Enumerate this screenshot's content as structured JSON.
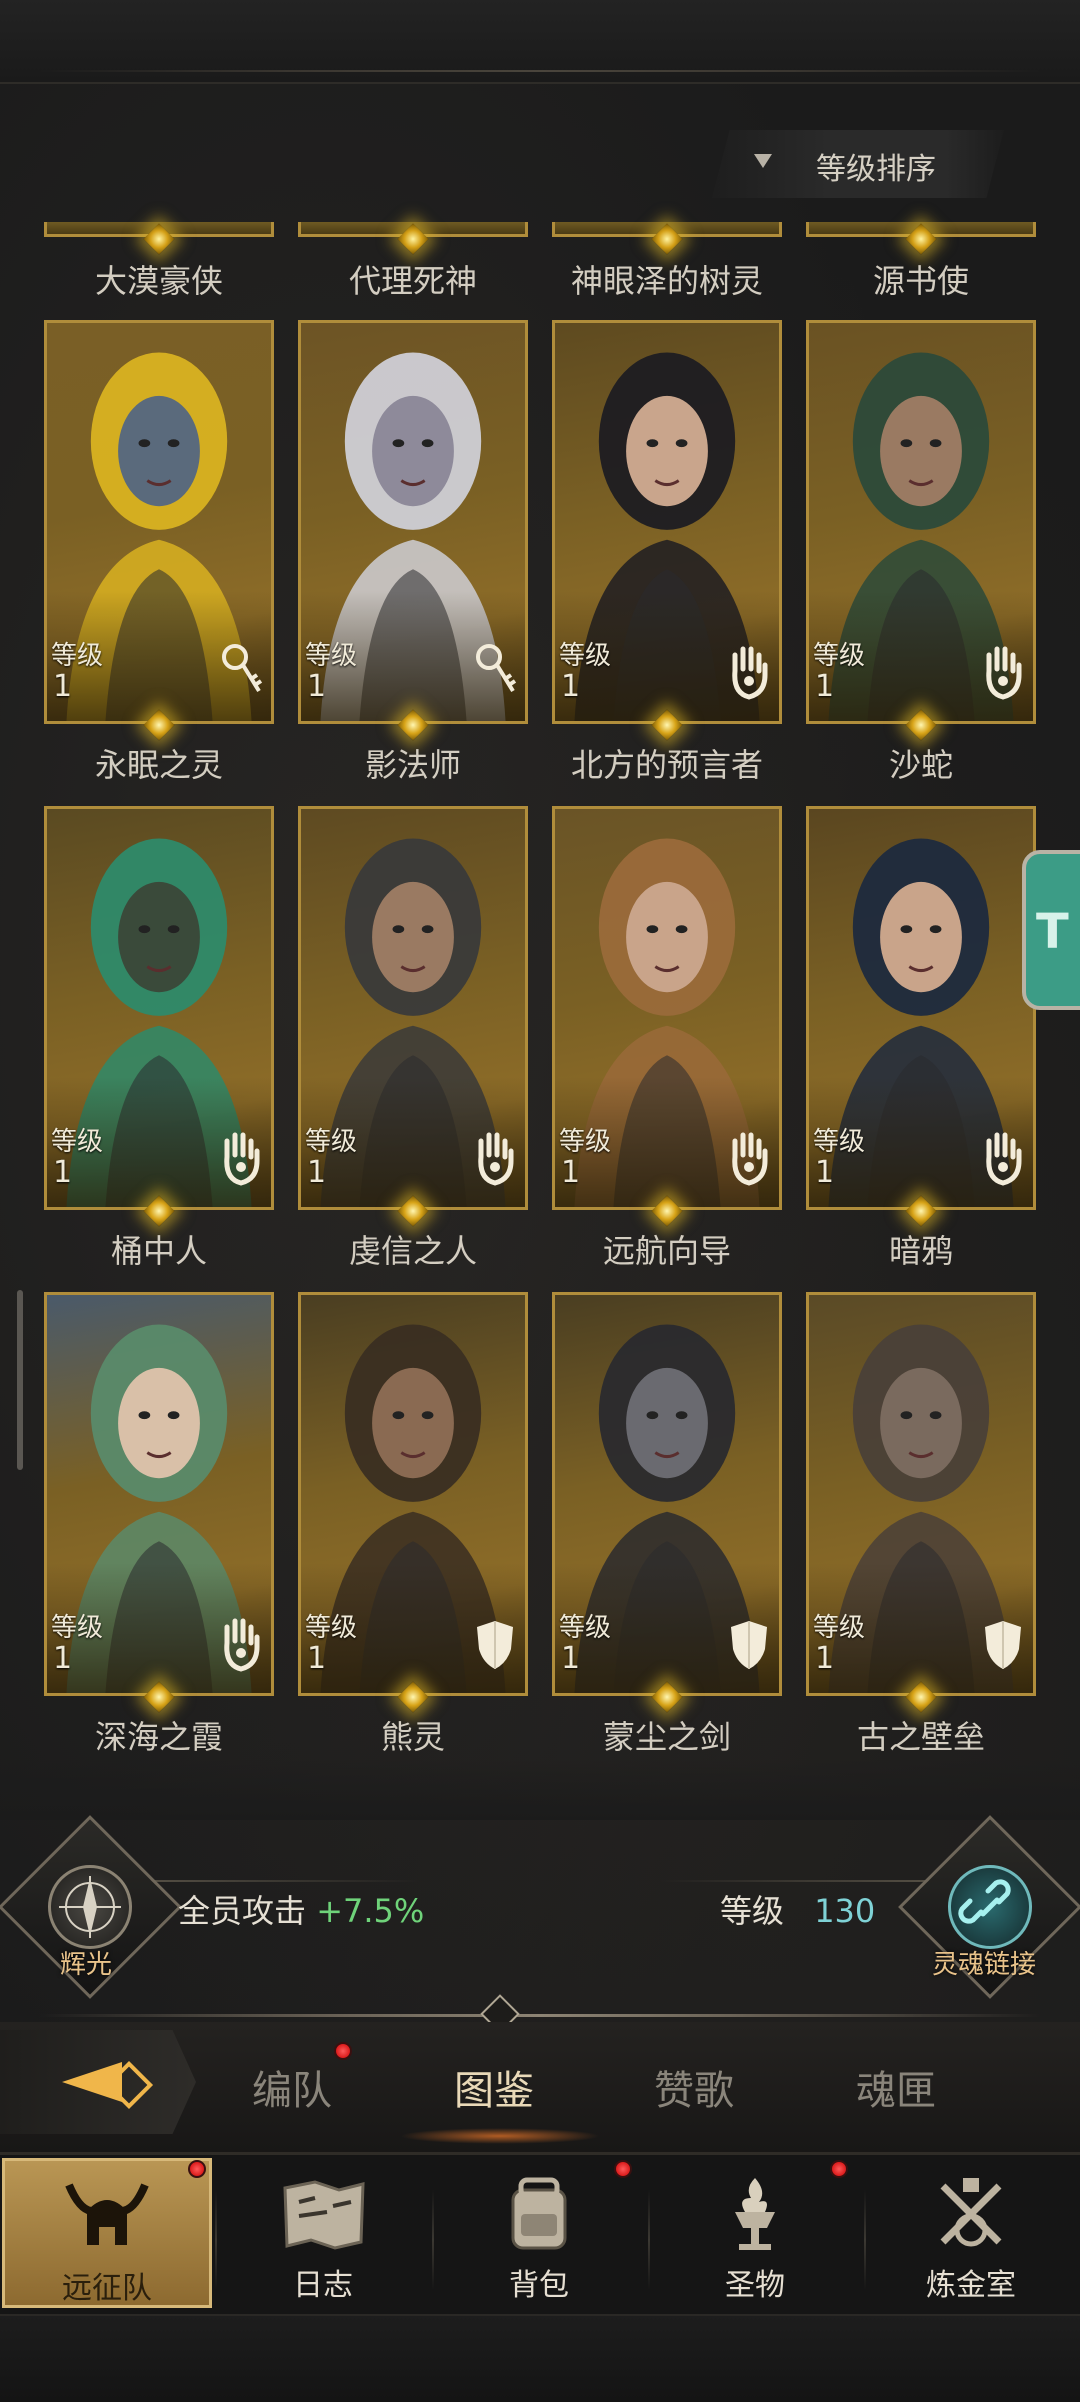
{
  "sort": {
    "label": "等级排序"
  },
  "top_row_names": [
    "大漠豪侠",
    "代理死神",
    "神眼泽的树灵",
    "源书使"
  ],
  "rows": [
    {
      "cards": [
        {
          "name": "永眠之灵",
          "level_label": "等级",
          "level": "1",
          "class_icon": "key-icon",
          "bg": "#7a5f26",
          "skin": "#5a6a7c",
          "hair": "#d9b221"
        },
        {
          "name": "影法师",
          "level_label": "等级",
          "level": "1",
          "class_icon": "key-icon",
          "bg": "#6d5425",
          "skin": "#8e8a9a",
          "hair": "#cfcfd6"
        },
        {
          "name": "北方的预言者",
          "level_label": "等级",
          "level": "1",
          "class_icon": "palm-icon",
          "bg": "#5e4a20",
          "skin": "#c9a58c",
          "hair": "#1d1c22"
        },
        {
          "name": "沙蛇",
          "level_label": "等级",
          "level": "1",
          "class_icon": "palm-icon",
          "bg": "#6a5223",
          "skin": "#9a7a62",
          "hair": "#2c4a3a"
        }
      ]
    },
    {
      "cards": [
        {
          "name": "桶中人",
          "level_label": "等级",
          "level": "1",
          "class_icon": "palm-icon",
          "bg": "#5a4a22",
          "skin": "#3a4a3a",
          "hair": "#2e8a6a"
        },
        {
          "name": "虔信之人",
          "level_label": "等级",
          "level": "1",
          "class_icon": "palm-icon",
          "bg": "#5e4a22",
          "skin": "#9a7a62",
          "hair": "#3a3a3a"
        },
        {
          "name": "远航向导",
          "level_label": "等级",
          "level": "1",
          "class_icon": "palm-icon",
          "bg": "#6a5426",
          "skin": "#c9a48a",
          "hair": "#9a6a3a"
        },
        {
          "name": "暗鸦",
          "level_label": "等级",
          "level": "1",
          "class_icon": "palm-icon",
          "bg": "#5a4620",
          "skin": "#c9a48a",
          "hair": "#1e2a3e"
        }
      ]
    },
    {
      "cards": [
        {
          "name": "深海之霞",
          "level_label": "等级",
          "level": "1",
          "class_icon": "palm-icon",
          "bg": "#4a5a6a",
          "skin": "#d9c0a8",
          "hair": "#5a8a6a"
        },
        {
          "name": "熊灵",
          "level_label": "等级",
          "level": "1",
          "class_icon": "shield-icon",
          "bg": "#4a3e22",
          "skin": "#8a6a52",
          "hair": "#3a2e22"
        },
        {
          "name": "蒙尘之剑",
          "level_label": "等级",
          "level": "1",
          "class_icon": "shield-icon",
          "bg": "#4a3e22",
          "skin": "#6a6a70",
          "hair": "#2a2a2e"
        },
        {
          "name": "古之壁垒",
          "level_label": "等级",
          "level": "1",
          "class_icon": "shield-icon",
          "bg": "#5a4a26",
          "skin": "#7a6a5e",
          "hair": "#4a4038"
        }
      ]
    }
  ],
  "floating_tab": {
    "text": "T"
  },
  "stats": {
    "left_emblem_label": "辉光",
    "attack_label": "全员攻击",
    "attack_value": "+7.5%",
    "level_label": "等级",
    "level_value": "130",
    "right_emblem_label": "灵魂链接"
  },
  "sub_tabs": [
    "编队",
    "图鉴",
    "赞歌",
    "魂匣"
  ],
  "nav": [
    "远征队",
    "日志",
    "背包",
    "圣物",
    "炼金室"
  ],
  "colors": {
    "accent_gold": "#b08d3b",
    "positive": "#6fd37a",
    "level_cyan": "#7fd2d6"
  }
}
